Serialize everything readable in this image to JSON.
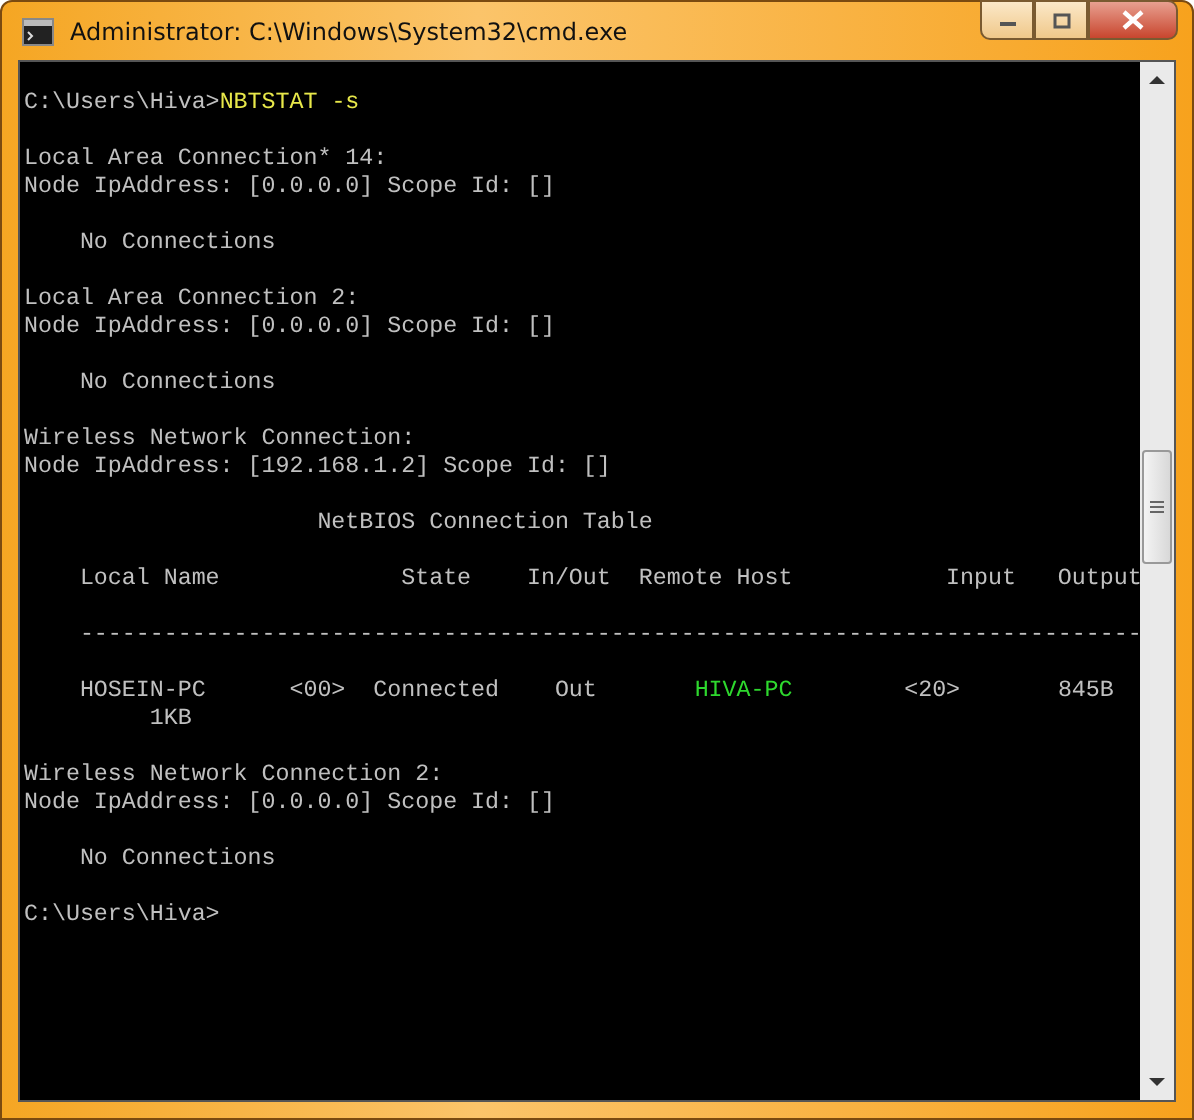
{
  "window": {
    "title": "Administrator: C:\\Windows\\System32\\cmd.exe"
  },
  "console": {
    "blocks": [
      [
        [
          {
            "text": "C:\\Users\\Hiva>",
            "color": "#c0c0c0"
          },
          {
            "text": "NBTSTAT -s",
            "color": "#e8e84a"
          }
        ]
      ],
      [
        [
          {
            "text": "Local Area Connection* 14:",
            "color": "#c0c0c0"
          }
        ],
        [
          {
            "text": "Node IpAddress: [0.0.0.0] Scope Id: []",
            "color": "#c0c0c0"
          }
        ]
      ],
      [
        [
          {
            "text": "    No Connections",
            "color": "#c0c0c0"
          }
        ]
      ],
      [
        [
          {
            "text": "Local Area Connection 2:",
            "color": "#c0c0c0"
          }
        ],
        [
          {
            "text": "Node IpAddress: [0.0.0.0] Scope Id: []",
            "color": "#c0c0c0"
          }
        ]
      ],
      [
        [
          {
            "text": "    No Connections",
            "color": "#c0c0c0"
          }
        ]
      ],
      [
        [
          {
            "text": "Wireless Network Connection:",
            "color": "#c0c0c0"
          }
        ],
        [
          {
            "text": "Node IpAddress: [192.168.1.2] Scope Id: []",
            "color": "#c0c0c0"
          }
        ]
      ],
      [
        [
          {
            "text": "                     NetBIOS Connection Table",
            "color": "#c0c0c0"
          }
        ]
      ],
      [
        [
          {
            "text": "    Local Name             State    In/Out  Remote Host           Input   Output",
            "color": "#c0c0c0"
          }
        ]
      ],
      [
        [
          {
            "text": "    ----------------------------------------------------------------------------",
            "color": "#c0c0c0"
          }
        ]
      ],
      [
        [
          {
            "text": "    HOSEIN-PC      <00>  Connected    Out       ",
            "color": "#c0c0c0"
          },
          {
            "text": "HIVA-PC",
            "color": "#2ed82e"
          },
          {
            "text": "        <20>       845B",
            "color": "#c0c0c0"
          }
        ],
        [
          {
            "text": "         1KB",
            "color": "#c0c0c0"
          }
        ]
      ],
      [
        [
          {
            "text": "Wireless Network Connection 2:",
            "color": "#c0c0c0"
          }
        ],
        [
          {
            "text": "Node IpAddress: [0.0.0.0] Scope Id: []",
            "color": "#c0c0c0"
          }
        ]
      ],
      [
        [
          {
            "text": "    No Connections",
            "color": "#c0c0c0"
          }
        ]
      ],
      [
        [
          {
            "text": "C:\\Users\\Hiva>",
            "color": "#c0c0c0"
          }
        ]
      ]
    ]
  }
}
